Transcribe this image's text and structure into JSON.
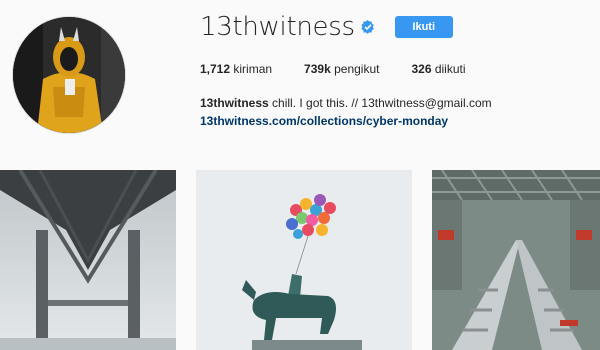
{
  "profile": {
    "username": "13thwitness",
    "follow_label": "Ikuti",
    "verified_icon": "verified-badge-icon",
    "stats": [
      {
        "value": "1,712",
        "label": "kiriman"
      },
      {
        "value": "739k",
        "label": "pengikut"
      },
      {
        "value": "326",
        "label": "diikuti"
      }
    ],
    "bio_name": "13thwitness",
    "bio_text": "chill. I got this. // 13thwitness@gmail.com",
    "bio_link": "13thwitness.com/collections/cyber-monday"
  },
  "posts": [
    {
      "subject": "bridge underside in fog"
    },
    {
      "subject": "equestrian statue with balloons"
    },
    {
      "subject": "subway trains in rail yard"
    }
  ],
  "colors": {
    "accent": "#3897f0",
    "background": "#fafafa",
    "text": "#262626",
    "link": "#003569"
  }
}
